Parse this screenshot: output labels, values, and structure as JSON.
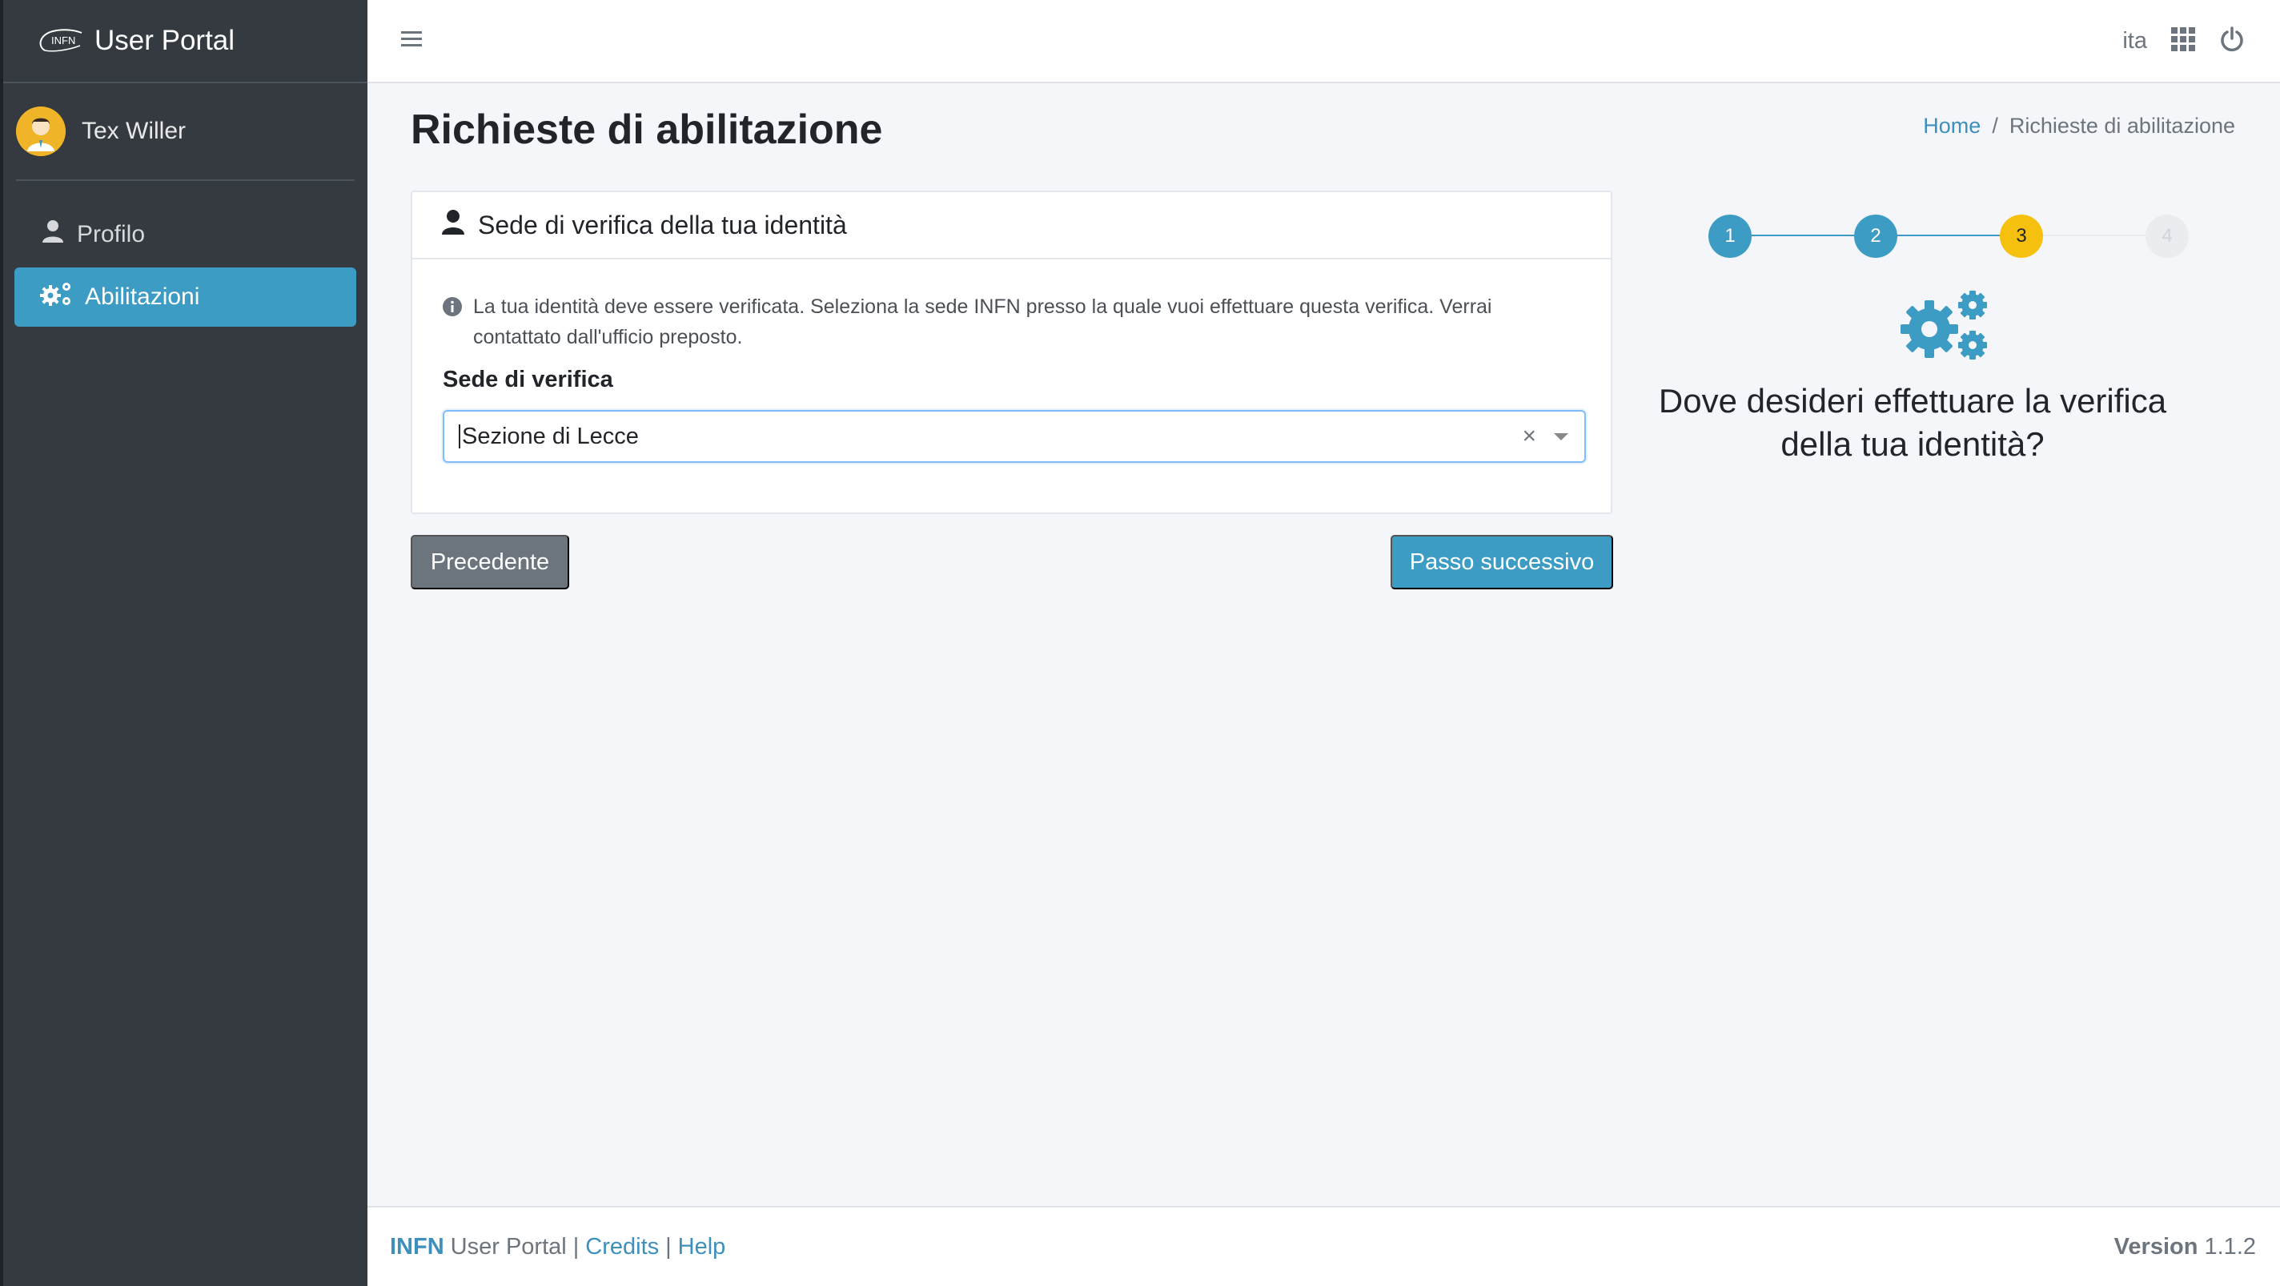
{
  "app": {
    "brand_logo_text": "INFN",
    "brand_name": "User Portal"
  },
  "user": {
    "name": "Tex Willer"
  },
  "sidebar": {
    "items": [
      {
        "label": "Profilo",
        "icon": "user-icon",
        "active": false
      },
      {
        "label": "Abilitazioni",
        "icon": "cogs-icon",
        "active": true
      }
    ]
  },
  "topbar": {
    "language": "ita",
    "icons": [
      "menu-icon",
      "apps-grid-icon",
      "power-icon"
    ]
  },
  "page": {
    "title": "Richieste di abilitazione",
    "breadcrumb": {
      "home": "Home",
      "separator": "/",
      "current": "Richieste di abilitazione"
    }
  },
  "card": {
    "header": "Sede di verifica della tua identità",
    "info": "La tua identità deve essere verificata. Seleziona la sede INFN presso la quale vuoi effettuare questa verifica. Verrai contattato dall'ufficio preposto.",
    "field_label": "Sede di verifica",
    "select_value": "Sezione di Lecce",
    "clear_symbol": "×"
  },
  "buttons": {
    "prev": "Precedente",
    "next": "Passo successivo"
  },
  "stepper": {
    "steps": [
      {
        "label": "1",
        "state": "done"
      },
      {
        "label": "2",
        "state": "done"
      },
      {
        "label": "3",
        "state": "current"
      },
      {
        "label": "4",
        "state": "todo"
      }
    ],
    "question": "Dove desideri effettuare la verifica della tua identità?"
  },
  "footer": {
    "brand": "INFN",
    "name": "User Portal",
    "separator": "|",
    "credits": "Credits",
    "help": "Help",
    "version_label": "Version",
    "version_number": "1.1.2"
  },
  "colors": {
    "sidebar_bg": "#343a40",
    "accent": "#3d9cc4",
    "current_step": "#f6c10e",
    "secondary": "#6c757d"
  }
}
